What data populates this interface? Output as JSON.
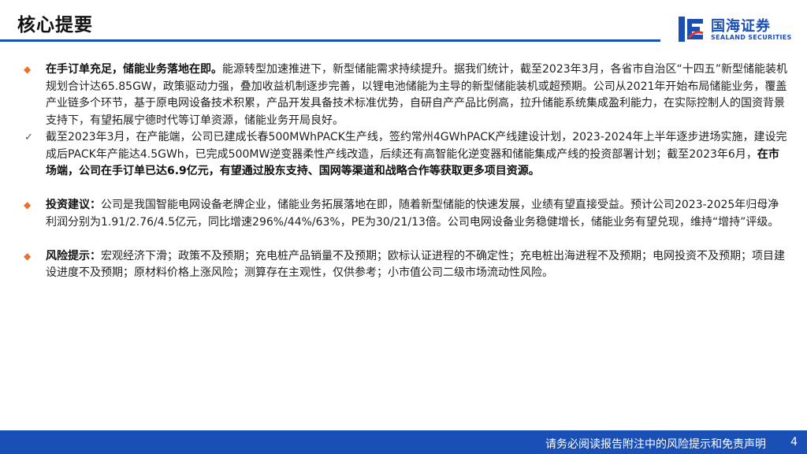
{
  "header": {
    "title": "核心提要"
  },
  "logo": {
    "cn": "国海证券",
    "en": "SEALAND SECURITIES",
    "brand_color": "#1a4fb5"
  },
  "bullets": {
    "b1": {
      "bold": "在手订单充足，储能业务落地在即。",
      "text": "能源转型加速推进下，新型储能需求持续提升。据我们统计，截至2023年3月，各省市自治区“十四五”新型储能装机规划合计达65.85GW，政策驱动力强，叠加收益机制逐步完善，以锂电池储能为主导的新型储能装机或超预期。公司从2021年开始布局储能业务，覆盖产业链多个环节，基于原电网设备技术积累，产品开发具备技术标准优势，自研自产产品比例高，拉升储能系统集成盈利能力，在实际控制人的国资背景支持下，有望拓展宁德时代等订单资源，储能业务开局良好。"
    },
    "b2": {
      "text": "截至2023年3月，在产能端，公司已建成长春500MWhPACK生产线，签约常州4GWhPACK产线建设计划，2023-2024年上半年逐步进场实施，建设完成后PACK年产能达4.5GWh，已完成500MW逆变器柔性产线改造，后续还有高智能化逆变器和储能集成产线的投资部署计划；截至2023年6月，",
      "bold": "在市场端，公司在手订单已达6.9亿元，有望通过股东支持、国网等渠道和战略合作等获取更多项目资源。"
    },
    "b3": {
      "bold": "投资建议：",
      "text": "公司是我国智能电网设备老牌企业，储能业务拓展落地在即，随着新型储能的快速发展，业绩有望直接受益。预计公司2023-2025年归母净利润分别为1.91/2.76/4.5亿元，同比增速296%/44%/63%，PE为30/21/13倍。公司电网设备业务稳健增长，储能业务有望兑现，维持“增持”评级。"
    },
    "b4": {
      "bold": "风险提示：",
      "text": "宏观经济下滑；政策不及预期；充电桩产品销量不及预期；欧标认证进程的不确定性；充电桩出海进程不及预期；电网投资不及预期；项目建设进度不及预期；原材料价格上涨风险；测算存在主观性，仅供参考；小市值公司二级市场流动性风险。"
    }
  },
  "footer": {
    "disclaimer": "请务必阅读报告附注中的风险提示和免责声明",
    "page": "4"
  }
}
